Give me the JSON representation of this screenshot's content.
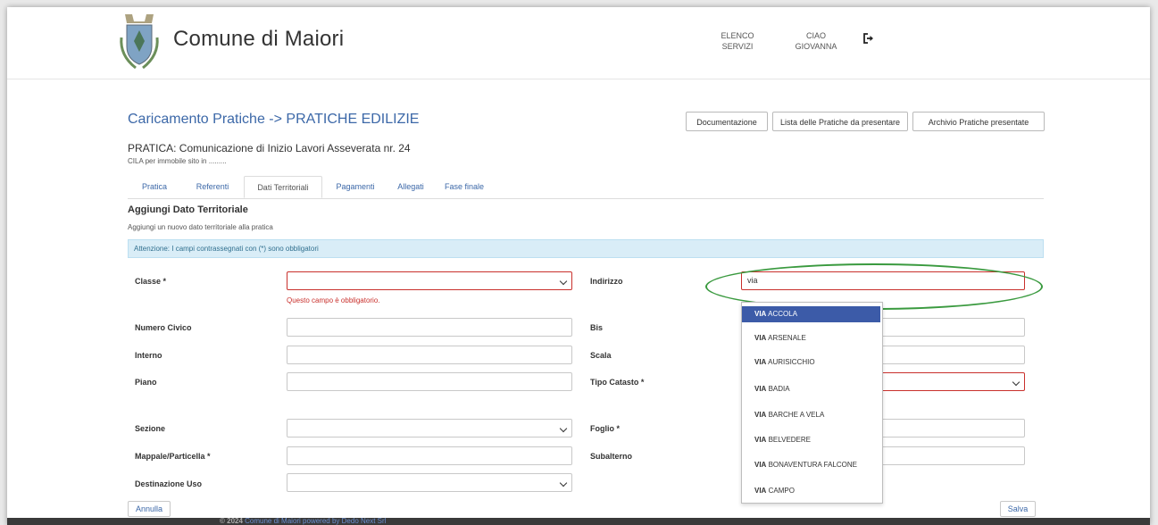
{
  "header": {
    "site_title": "Comune di Maiori",
    "nav_elenco_line1": "ELENCO",
    "nav_elenco_line2": "SERVIZI",
    "nav_user_line1": "CIAO",
    "nav_user_line2": "GIOVANNA",
    "logout_icon": "logout-icon"
  },
  "page_title": "Caricamento Pratiche -> PRATICHE EDILIZIE",
  "top_buttons": {
    "documentazione": "Documentazione",
    "lista": "Lista delle Pratiche da presentare",
    "archivio": "Archivio Pratiche presentate"
  },
  "pratica": {
    "title": "PRATICA: Comunicazione di Inizio Lavori Asseverata nr. 24",
    "subtitle": "CILA per immobile sito in ........."
  },
  "tabs": [
    "Pratica",
    "Referenti",
    "Dati Territoriali",
    "Pagamenti",
    "Allegati",
    "Fase finale"
  ],
  "active_tab": "Dati Territoriali",
  "section": {
    "title": "Aggiungi Dato Territoriale",
    "subtitle": "Aggiungi un nuovo dato territoriale alla pratica",
    "alert": "Attenzione: I campi contrassegnati con (*) sono obbligatori"
  },
  "form": {
    "classe_label": "Classe *",
    "classe_value": "",
    "classe_error": "Questo campo è obbligatorio.",
    "indirizzo_label": "Indirizzo",
    "indirizzo_value": "via",
    "numero_civico_label": "Numero Civico",
    "bis_label": "Bis",
    "interno_label": "Interno",
    "scala_label": "Scala",
    "piano_label": "Piano",
    "tipo_catasto_label": "Tipo Catasto *",
    "sezione_label": "Sezione",
    "foglio_label": "Foglio *",
    "mappale_label": "Mappale/Particella *",
    "subalterno_label": "Subalterno",
    "destinazione_label": "Destinazione Uso"
  },
  "autocomplete": {
    "match": "VIA",
    "items": [
      "ACCOLA",
      "ARSENALE",
      "AURISICCHIO",
      "BADIA",
      "BARCHE A VELA",
      "BELVEDERE",
      "BONAVENTURA FALCONE",
      "CAMPO"
    ],
    "selected": "ACCOLA"
  },
  "footer_buttons": {
    "annulla": "Annulla",
    "salva": "Salva"
  },
  "footer": {
    "prefix": "© 2024 ",
    "link": "Comune di Maiori powered by Dedo Next Srl"
  },
  "colors": {
    "accent": "#3c68a8",
    "error": "#c9302c",
    "alert_bg": "#d9edf7",
    "annotation": "#3a9a3f",
    "dropdown_selected": "#3c5ba8"
  }
}
